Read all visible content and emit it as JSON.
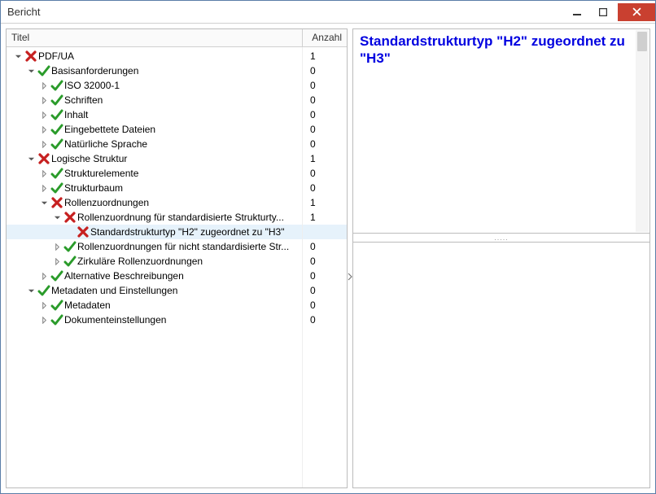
{
  "window": {
    "title": "Bericht"
  },
  "columns": {
    "title": "Titel",
    "count": "Anzahl"
  },
  "detail": {
    "headline": "Standardstrukturtyp \"H2\" zugeordnet zu \"H3\""
  },
  "splitter_label": ".....",
  "tree": [
    {
      "depth": 0,
      "status": "fail",
      "expander": "down",
      "label": "PDF/UA",
      "count": 1,
      "selected": false
    },
    {
      "depth": 1,
      "status": "pass",
      "expander": "down",
      "label": "Basisanforderungen",
      "count": 0,
      "selected": false
    },
    {
      "depth": 2,
      "status": "pass",
      "expander": "right",
      "label": "ISO 32000-1",
      "count": 0,
      "selected": false
    },
    {
      "depth": 2,
      "status": "pass",
      "expander": "right",
      "label": "Schriften",
      "count": 0,
      "selected": false
    },
    {
      "depth": 2,
      "status": "pass",
      "expander": "right",
      "label": "Inhalt",
      "count": 0,
      "selected": false
    },
    {
      "depth": 2,
      "status": "pass",
      "expander": "right",
      "label": "Eingebettete Dateien",
      "count": 0,
      "selected": false
    },
    {
      "depth": 2,
      "status": "pass",
      "expander": "right",
      "label": "Natürliche Sprache",
      "count": 0,
      "selected": false
    },
    {
      "depth": 1,
      "status": "fail",
      "expander": "down",
      "label": "Logische Struktur",
      "count": 1,
      "selected": false
    },
    {
      "depth": 2,
      "status": "pass",
      "expander": "right",
      "label": "Strukturelemente",
      "count": 0,
      "selected": false
    },
    {
      "depth": 2,
      "status": "pass",
      "expander": "right",
      "label": "Strukturbaum",
      "count": 0,
      "selected": false
    },
    {
      "depth": 2,
      "status": "fail",
      "expander": "down",
      "label": "Rollenzuordnungen",
      "count": 1,
      "selected": false
    },
    {
      "depth": 3,
      "status": "fail",
      "expander": "down",
      "label": "Rollenzuordnung für standardisierte Strukturty...",
      "count": 1,
      "selected": false
    },
    {
      "depth": 4,
      "status": "fail",
      "expander": "none",
      "label": "Standardstrukturtyp \"H2\" zugeordnet zu \"H3\"",
      "count": "",
      "selected": true
    },
    {
      "depth": 3,
      "status": "pass",
      "expander": "right",
      "label": "Rollenzuordnungen für nicht standardisierte Str...",
      "count": 0,
      "selected": false
    },
    {
      "depth": 3,
      "status": "pass",
      "expander": "right",
      "label": "Zirkuläre Rollenzuordnungen",
      "count": 0,
      "selected": false
    },
    {
      "depth": 2,
      "status": "pass",
      "expander": "right",
      "label": "Alternative Beschreibungen",
      "count": 0,
      "selected": false
    },
    {
      "depth": 1,
      "status": "pass",
      "expander": "down",
      "label": "Metadaten und Einstellungen",
      "count": 0,
      "selected": false
    },
    {
      "depth": 2,
      "status": "pass",
      "expander": "right",
      "label": "Metadaten",
      "count": 0,
      "selected": false
    },
    {
      "depth": 2,
      "status": "pass",
      "expander": "right",
      "label": "Dokumenteinstellungen",
      "count": 0,
      "selected": false
    }
  ]
}
